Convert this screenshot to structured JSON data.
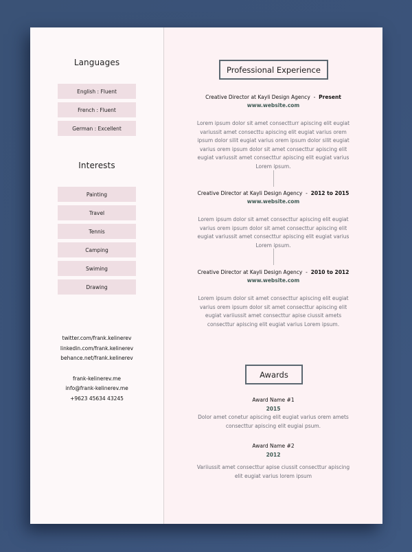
{
  "sidebar": {
    "languages": {
      "heading": "Languages",
      "items": [
        "English : Fluent",
        "French : Fluent",
        "German : Excellent"
      ]
    },
    "interests": {
      "heading": "Interests",
      "items": [
        "Painting",
        "Travel",
        "Tennis",
        "Camping",
        "Swiming",
        "Drawing"
      ]
    },
    "social": [
      "twitter.com/frank.kelinerev",
      "linkedin.com/frank.kelinerev",
      "behance.net/frank.kelinerev"
    ],
    "contact": [
      "frank-kelinerev.me",
      "info@frank-kelinerev.me",
      "+9623 45634 43245"
    ]
  },
  "experience": {
    "heading": "Professional Experience",
    "jobs": [
      {
        "title": "Creative Director at Kayli Design Agency",
        "separator": "-",
        "period": "Present",
        "link": "www.website.com",
        "description": "Lorem ipsum dolor sit amet consectturr apiscing elit eugiat variussit amet consecttu apiscing elit eugiat varius orem ipsum dolor silit eugiat varius orem ipsum dolor silit eugiat varius orem ipsum dolor sit amet consecttur apiscing elit eugiat variussit amet consecttur apiscing elit eugiat varius Lorem ipsum."
      },
      {
        "title": "Creative Director at Kayli Design Agency",
        "separator": "-",
        "period": "2012 to 2015",
        "link": "www.website.com",
        "description": "Lorem ipsum dolor sit amet consecttur apiscing elit eugiat varius orem ipsum dolor sit amet consecttur apiscing elit eugiat variussit amet consecttur apiscing elit eugiat varius Lorem ipsum."
      },
      {
        "title": "Creative Director at Kayli Design Agency",
        "separator": "-",
        "period": "2010 to 2012",
        "link": "www.website.com",
        "description": "Lorem ipsum dolor sit amet consecttur apiscing elit eugiat varius orem ipsum dolor sit amet consecttur apiscing elit eugiat variiussit amet consecttur apise ciussit amets consecttur apiscing elit eugiat varius Lorem ipsum."
      }
    ]
  },
  "awards": {
    "heading": "Awards",
    "items": [
      {
        "name": "Award Name #1",
        "year": "2015",
        "description": "Dolor amet conetur apiscing elit eugiat varius orem amets consecttur apiscing elit eugiai psum."
      },
      {
        "name": "Award Name #2",
        "year": "2012",
        "description": "Variiussit amet consecttur apise ciussit consecttur apiscing elit eugiat varius lorem ipsum"
      }
    ]
  },
  "colors": {
    "background": "#3b537a",
    "page_left": "#fdf8f9",
    "page_right": "#fdf2f4",
    "pill": "#efdee3",
    "section_border": "#5b6770",
    "link": "#3f5a54",
    "body_text": "#6d6f78"
  }
}
